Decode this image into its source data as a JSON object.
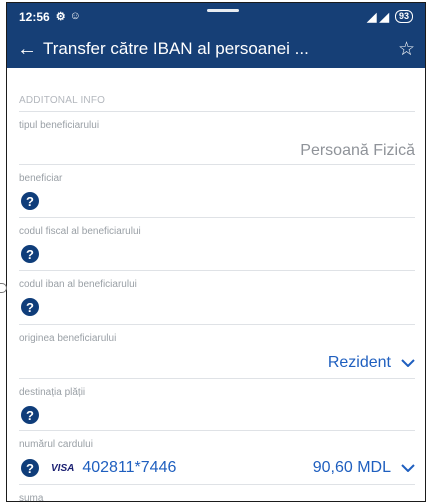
{
  "status_bar": {
    "time": "12:56",
    "left_icons": [
      "⚙",
      "☺"
    ],
    "signal": "◢ ◢",
    "battery": "93"
  },
  "app_bar": {
    "back": "←",
    "title": "Transfer către IBAN al persoanei ...",
    "star": "☆"
  },
  "form": {
    "section_title": "ADDITONAL INFO",
    "fields": [
      {
        "label": "tipul beneficiarului",
        "value": "Persoană Fizică"
      },
      {
        "label": "beneficiar"
      },
      {
        "label": "codul fiscal al beneficiarului"
      },
      {
        "label": "codul iban al beneficiarului"
      },
      {
        "label": "originea beneficiarului",
        "value": "Rezident"
      },
      {
        "label": "destinația plății"
      },
      {
        "label": "numărul cardului",
        "card_brand": "VISA",
        "card_number": "402811*7446",
        "amount": "90,60 MDL"
      },
      {
        "label": "suma"
      }
    ],
    "help_glyph": "?"
  },
  "colors": {
    "primary": "#163f76",
    "accent": "#1f5fbf",
    "help": "#0f3d7a"
  }
}
